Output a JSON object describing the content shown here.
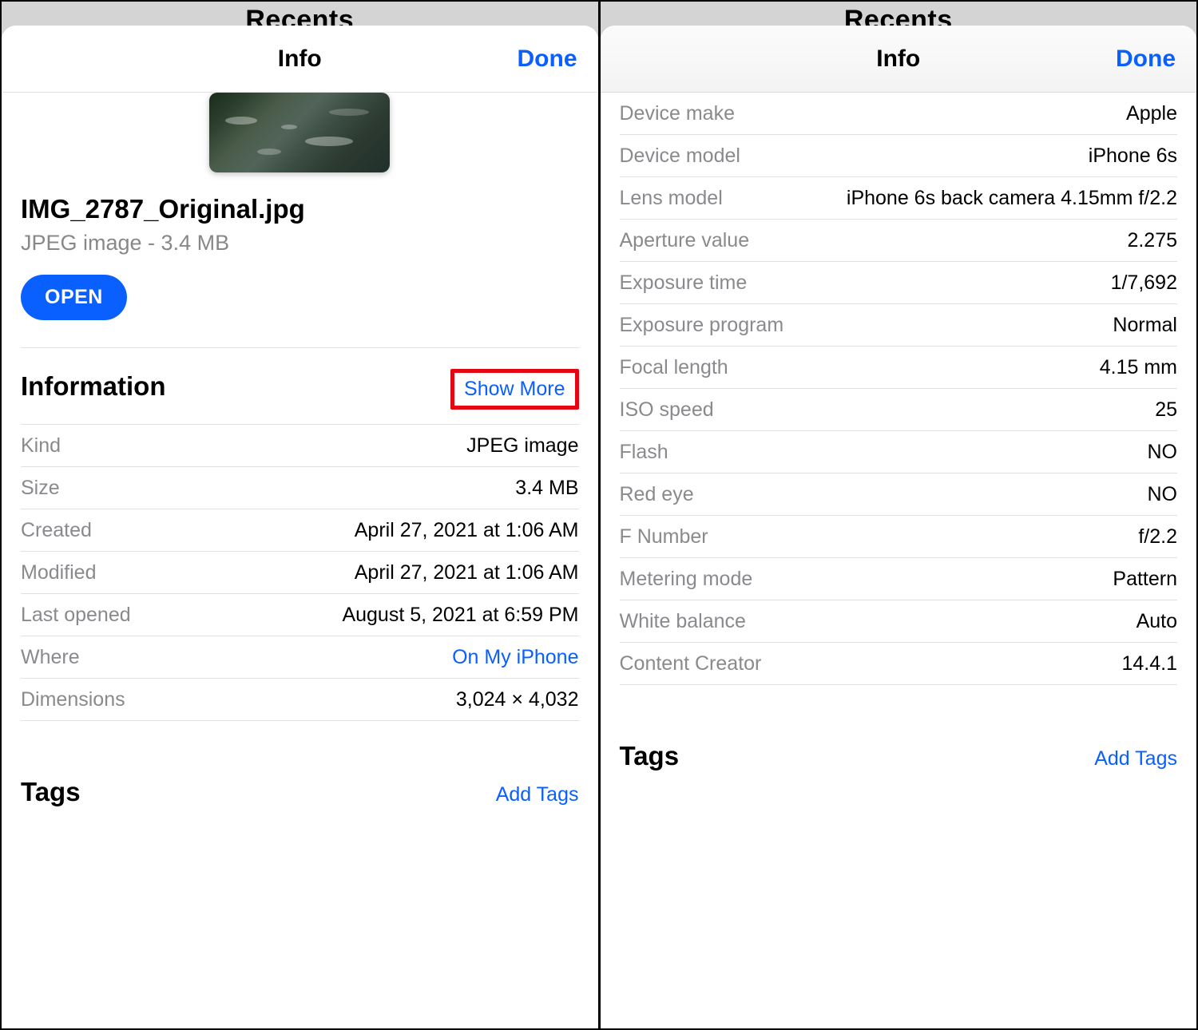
{
  "background": {
    "title": "Recents"
  },
  "header": {
    "title": "Info",
    "done": "Done"
  },
  "file": {
    "name": "IMG_2787_Original.jpg",
    "subtitle": "JPEG image - 3.4 MB",
    "open_label": "OPEN"
  },
  "information": {
    "heading": "Information",
    "show_more": "Show More",
    "rows": [
      {
        "label": "Kind",
        "value": "JPEG image"
      },
      {
        "label": "Size",
        "value": "3.4 MB"
      },
      {
        "label": "Created",
        "value": "April 27, 2021 at 1:06 AM"
      },
      {
        "label": "Modified",
        "value": "April 27, 2021 at 1:06 AM"
      },
      {
        "label": "Last opened",
        "value": "August 5, 2021 at 6:59 PM"
      },
      {
        "label": "Where",
        "value": "On My iPhone",
        "link": true
      },
      {
        "label": "Dimensions",
        "value": "3,024 × 4,032"
      }
    ]
  },
  "exif": {
    "rows": [
      {
        "label": "Device make",
        "value": "Apple"
      },
      {
        "label": "Device model",
        "value": "iPhone 6s"
      },
      {
        "label": "Lens model",
        "value": "iPhone 6s back camera 4.15mm f/2.2"
      },
      {
        "label": "Aperture value",
        "value": "2.275"
      },
      {
        "label": "Exposure time",
        "value": "1/7,692"
      },
      {
        "label": "Exposure program",
        "value": "Normal"
      },
      {
        "label": "Focal length",
        "value": "4.15 mm"
      },
      {
        "label": "ISO speed",
        "value": "25"
      },
      {
        "label": "Flash",
        "value": "NO"
      },
      {
        "label": "Red eye",
        "value": "NO"
      },
      {
        "label": "F Number",
        "value": "f/2.2"
      },
      {
        "label": "Metering mode",
        "value": "Pattern"
      },
      {
        "label": "White balance",
        "value": "Auto"
      },
      {
        "label": "Content Creator",
        "value": "14.4.1"
      }
    ]
  },
  "tags": {
    "heading": "Tags",
    "add": "Add Tags"
  }
}
